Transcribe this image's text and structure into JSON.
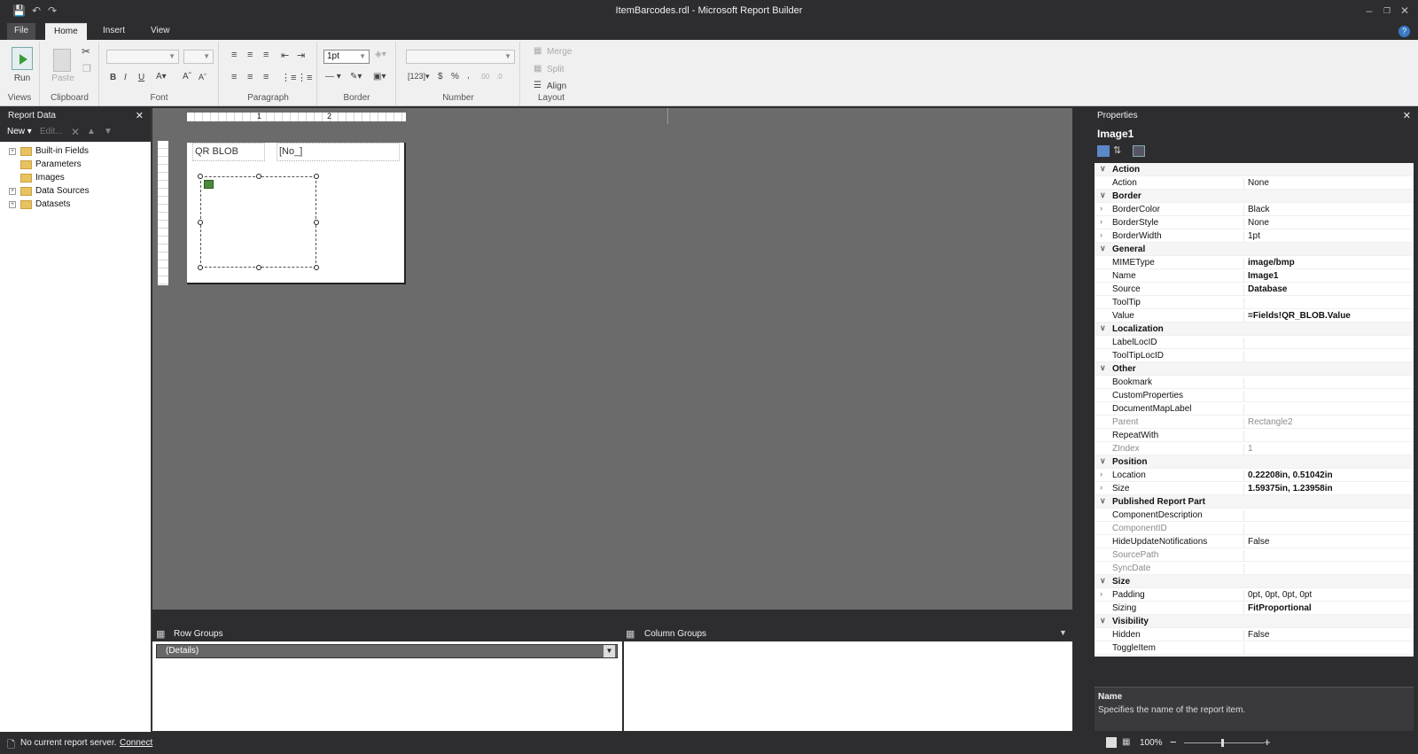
{
  "window": {
    "title": "ItemBarcodes.rdl - Microsoft Report Builder"
  },
  "ribbon_tabs": {
    "file": "File",
    "home": "Home",
    "insert": "Insert",
    "view": "View"
  },
  "ribbon": {
    "run": "Run",
    "paste": "Paste",
    "border_width": "1pt",
    "merge": "Merge",
    "split": "Split",
    "align": "Align",
    "groups": {
      "views": "Views",
      "clipboard": "Clipboard",
      "font": "Font",
      "paragraph": "Paragraph",
      "border": "Border",
      "number": "Number",
      "layout": "Layout"
    }
  },
  "report_data": {
    "title": "Report Data",
    "new_label": "New",
    "edit_label": "Edit...",
    "items": [
      {
        "label": "Built-in Fields",
        "expandable": true
      },
      {
        "label": "Parameters",
        "expandable": false
      },
      {
        "label": "Images",
        "expandable": false
      },
      {
        "label": "Data Sources",
        "expandable": true
      },
      {
        "label": "Datasets",
        "expandable": true
      }
    ]
  },
  "canvas": {
    "header_cell1": "QR BLOB",
    "header_cell2": "[No_]",
    "ruler_marks": [
      "1",
      "2"
    ]
  },
  "groups": {
    "row_title": "Row Groups",
    "col_title": "Column Groups",
    "details": "(Details)"
  },
  "properties": {
    "title": "Properties",
    "object": "Image1",
    "rows": [
      {
        "type": "cat",
        "name": "Action"
      },
      {
        "name": "Action",
        "value": "None"
      },
      {
        "type": "cat",
        "name": "Border"
      },
      {
        "name": "BorderColor",
        "value": "Black",
        "expand": true
      },
      {
        "name": "BorderStyle",
        "value": "None",
        "expand": true
      },
      {
        "name": "BorderWidth",
        "value": "1pt",
        "expand": true
      },
      {
        "type": "cat",
        "name": "General"
      },
      {
        "name": "MIMEType",
        "value": "image/bmp",
        "bold": true
      },
      {
        "name": "Name",
        "value": "Image1",
        "bold": true
      },
      {
        "name": "Source",
        "value": "Database",
        "bold": true
      },
      {
        "name": "ToolTip",
        "value": ""
      },
      {
        "name": "Value",
        "value": "=Fields!QR_BLOB.Value",
        "bold": true
      },
      {
        "type": "cat",
        "name": "Localization"
      },
      {
        "name": "LabelLocID",
        "value": ""
      },
      {
        "name": "ToolTipLocID",
        "value": ""
      },
      {
        "type": "cat",
        "name": "Other"
      },
      {
        "name": "Bookmark",
        "value": ""
      },
      {
        "name": "CustomProperties",
        "value": ""
      },
      {
        "name": "DocumentMapLabel",
        "value": ""
      },
      {
        "name": "Parent",
        "value": "Rectangle2",
        "gray": true
      },
      {
        "name": "RepeatWith",
        "value": ""
      },
      {
        "name": "ZIndex",
        "value": "1",
        "gray": true
      },
      {
        "type": "cat",
        "name": "Position"
      },
      {
        "name": "Location",
        "value": "0.22208in, 0.51042in",
        "bold": true,
        "expand": true
      },
      {
        "name": "Size",
        "value": "1.59375in, 1.23958in",
        "bold": true,
        "expand": true
      },
      {
        "type": "cat",
        "name": "Published Report Part"
      },
      {
        "name": "ComponentDescription",
        "value": ""
      },
      {
        "name": "ComponentID",
        "value": "",
        "gray": true
      },
      {
        "name": "HideUpdateNotifications",
        "value": "False"
      },
      {
        "name": "SourcePath",
        "value": "",
        "gray": true
      },
      {
        "name": "SyncDate",
        "value": "",
        "gray": true
      },
      {
        "type": "cat",
        "name": "Size"
      },
      {
        "name": "Padding",
        "value": "0pt, 0pt, 0pt, 0pt",
        "expand": true
      },
      {
        "name": "Sizing",
        "value": "FitProportional",
        "bold": true
      },
      {
        "type": "cat",
        "name": "Visibility"
      },
      {
        "name": "Hidden",
        "value": "False"
      },
      {
        "name": "ToggleItem",
        "value": ""
      }
    ],
    "desc_title": "Name",
    "desc_text": "Specifies the name of the report item."
  },
  "status": {
    "message": "No current report server.",
    "connect": "Connect",
    "zoom": "100%"
  }
}
